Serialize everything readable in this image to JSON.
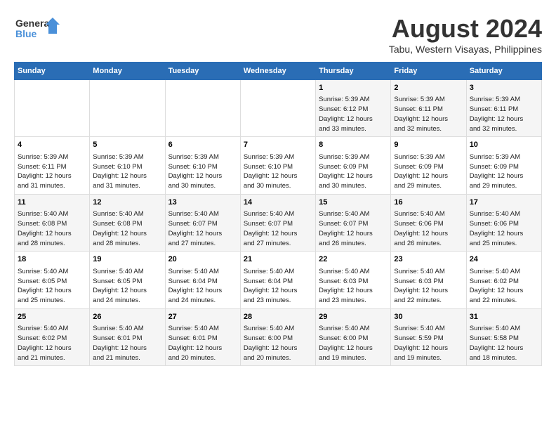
{
  "logo": {
    "line1": "General",
    "line2": "Blue"
  },
  "title": "August 2024",
  "subtitle": "Tabu, Western Visayas, Philippines",
  "days_of_week": [
    "Sunday",
    "Monday",
    "Tuesday",
    "Wednesday",
    "Thursday",
    "Friday",
    "Saturday"
  ],
  "weeks": [
    [
      {
        "day": "",
        "info": ""
      },
      {
        "day": "",
        "info": ""
      },
      {
        "day": "",
        "info": ""
      },
      {
        "day": "",
        "info": ""
      },
      {
        "day": "1",
        "info": "Sunrise: 5:39 AM\nSunset: 6:12 PM\nDaylight: 12 hours\nand 33 minutes."
      },
      {
        "day": "2",
        "info": "Sunrise: 5:39 AM\nSunset: 6:11 PM\nDaylight: 12 hours\nand 32 minutes."
      },
      {
        "day": "3",
        "info": "Sunrise: 5:39 AM\nSunset: 6:11 PM\nDaylight: 12 hours\nand 32 minutes."
      }
    ],
    [
      {
        "day": "4",
        "info": "Sunrise: 5:39 AM\nSunset: 6:11 PM\nDaylight: 12 hours\nand 31 minutes."
      },
      {
        "day": "5",
        "info": "Sunrise: 5:39 AM\nSunset: 6:10 PM\nDaylight: 12 hours\nand 31 minutes."
      },
      {
        "day": "6",
        "info": "Sunrise: 5:39 AM\nSunset: 6:10 PM\nDaylight: 12 hours\nand 30 minutes."
      },
      {
        "day": "7",
        "info": "Sunrise: 5:39 AM\nSunset: 6:10 PM\nDaylight: 12 hours\nand 30 minutes."
      },
      {
        "day": "8",
        "info": "Sunrise: 5:39 AM\nSunset: 6:09 PM\nDaylight: 12 hours\nand 30 minutes."
      },
      {
        "day": "9",
        "info": "Sunrise: 5:39 AM\nSunset: 6:09 PM\nDaylight: 12 hours\nand 29 minutes."
      },
      {
        "day": "10",
        "info": "Sunrise: 5:39 AM\nSunset: 6:09 PM\nDaylight: 12 hours\nand 29 minutes."
      }
    ],
    [
      {
        "day": "11",
        "info": "Sunrise: 5:40 AM\nSunset: 6:08 PM\nDaylight: 12 hours\nand 28 minutes."
      },
      {
        "day": "12",
        "info": "Sunrise: 5:40 AM\nSunset: 6:08 PM\nDaylight: 12 hours\nand 28 minutes."
      },
      {
        "day": "13",
        "info": "Sunrise: 5:40 AM\nSunset: 6:07 PM\nDaylight: 12 hours\nand 27 minutes."
      },
      {
        "day": "14",
        "info": "Sunrise: 5:40 AM\nSunset: 6:07 PM\nDaylight: 12 hours\nand 27 minutes."
      },
      {
        "day": "15",
        "info": "Sunrise: 5:40 AM\nSunset: 6:07 PM\nDaylight: 12 hours\nand 26 minutes."
      },
      {
        "day": "16",
        "info": "Sunrise: 5:40 AM\nSunset: 6:06 PM\nDaylight: 12 hours\nand 26 minutes."
      },
      {
        "day": "17",
        "info": "Sunrise: 5:40 AM\nSunset: 6:06 PM\nDaylight: 12 hours\nand 25 minutes."
      }
    ],
    [
      {
        "day": "18",
        "info": "Sunrise: 5:40 AM\nSunset: 6:05 PM\nDaylight: 12 hours\nand 25 minutes."
      },
      {
        "day": "19",
        "info": "Sunrise: 5:40 AM\nSunset: 6:05 PM\nDaylight: 12 hours\nand 24 minutes."
      },
      {
        "day": "20",
        "info": "Sunrise: 5:40 AM\nSunset: 6:04 PM\nDaylight: 12 hours\nand 24 minutes."
      },
      {
        "day": "21",
        "info": "Sunrise: 5:40 AM\nSunset: 6:04 PM\nDaylight: 12 hours\nand 23 minutes."
      },
      {
        "day": "22",
        "info": "Sunrise: 5:40 AM\nSunset: 6:03 PM\nDaylight: 12 hours\nand 23 minutes."
      },
      {
        "day": "23",
        "info": "Sunrise: 5:40 AM\nSunset: 6:03 PM\nDaylight: 12 hours\nand 22 minutes."
      },
      {
        "day": "24",
        "info": "Sunrise: 5:40 AM\nSunset: 6:02 PM\nDaylight: 12 hours\nand 22 minutes."
      }
    ],
    [
      {
        "day": "25",
        "info": "Sunrise: 5:40 AM\nSunset: 6:02 PM\nDaylight: 12 hours\nand 21 minutes."
      },
      {
        "day": "26",
        "info": "Sunrise: 5:40 AM\nSunset: 6:01 PM\nDaylight: 12 hours\nand 21 minutes."
      },
      {
        "day": "27",
        "info": "Sunrise: 5:40 AM\nSunset: 6:01 PM\nDaylight: 12 hours\nand 20 minutes."
      },
      {
        "day": "28",
        "info": "Sunrise: 5:40 AM\nSunset: 6:00 PM\nDaylight: 12 hours\nand 20 minutes."
      },
      {
        "day": "29",
        "info": "Sunrise: 5:40 AM\nSunset: 6:00 PM\nDaylight: 12 hours\nand 19 minutes."
      },
      {
        "day": "30",
        "info": "Sunrise: 5:40 AM\nSunset: 5:59 PM\nDaylight: 12 hours\nand 19 minutes."
      },
      {
        "day": "31",
        "info": "Sunrise: 5:40 AM\nSunset: 5:58 PM\nDaylight: 12 hours\nand 18 minutes."
      }
    ]
  ]
}
